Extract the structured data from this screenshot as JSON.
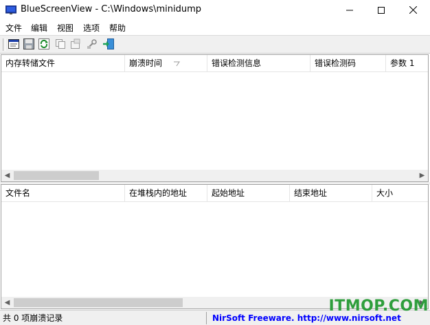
{
  "window": {
    "title": "BlueScreenView  -  C:\\Windows\\minidump",
    "minimize_icon": "minimize-icon",
    "maximize_icon": "maximize-icon",
    "close_icon": "close-icon"
  },
  "menu": [
    "文件",
    "编辑",
    "视图",
    "选项",
    "帮助"
  ],
  "toolbar": {
    "icons": [
      "html-report-icon",
      "save-icon",
      "refresh-icon",
      "copy-icon",
      "properties-icon",
      "advanced-options-icon",
      "exit-icon"
    ]
  },
  "top_table": {
    "columns": [
      "内存转储文件",
      "崩溃时间",
      "错误检测信息",
      "错误检测码",
      "参数 1"
    ],
    "sort_indicator": "sort-arrow-icon",
    "rows": []
  },
  "bottom_table": {
    "columns": [
      "文件名",
      "在堆栈内的地址",
      "起始地址",
      "结束地址",
      "大小"
    ],
    "rows": []
  },
  "status": {
    "records": "共 0 项崩溃记录",
    "link_text": "NirSoft Freeware.  http://www.nirsoft.net"
  },
  "watermark": "ITMOP.COM",
  "colors": {
    "link": "#0000ff",
    "watermark": "#2e9e3c",
    "app_icon": "#1c3ea8"
  }
}
